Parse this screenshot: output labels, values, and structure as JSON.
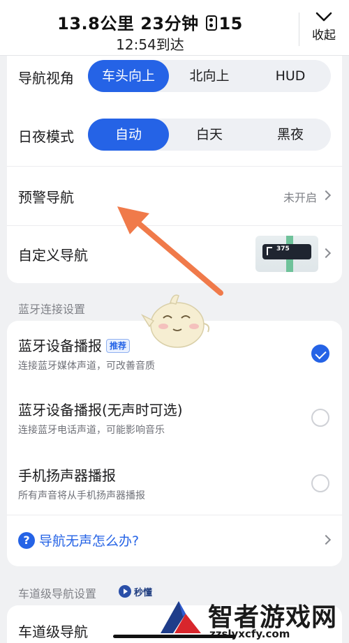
{
  "header": {
    "summary_distance": "13.8公里",
    "summary_time": "23分钟",
    "traffic_lights": "15",
    "eta": "12:54到达",
    "collapse_label": "收起"
  },
  "view_setting": {
    "label": "导航视角",
    "options": [
      "车头向上",
      "北向上",
      "HUD"
    ],
    "selected": "车头向上"
  },
  "day_night": {
    "label": "日夜模式",
    "options": [
      "自动",
      "白天",
      "黑夜"
    ],
    "selected": "自动"
  },
  "warning_nav": {
    "label": "预警导航",
    "status": "未开启"
  },
  "custom_nav": {
    "label": "自定义导航",
    "thumb_number": "375"
  },
  "bluetooth": {
    "section_title": "蓝牙连接设置",
    "items": [
      {
        "label": "蓝牙设备播报",
        "badge": "推荐",
        "desc": "连接蓝牙媒体声道，可改善音质",
        "checked": true
      },
      {
        "label": "蓝牙设备播报(无声时可选)",
        "desc": "连接蓝牙电话声道，可能影响音乐",
        "checked": false
      },
      {
        "label": "手机扬声器播报",
        "desc": "所有声音将从手机扬声器播报",
        "checked": false
      }
    ],
    "help_link": "导航无声怎么办?"
  },
  "lane_nav": {
    "section_title": "车道级导航设置",
    "video_badge": "秒懂",
    "row_label": "车道级导航"
  },
  "watermark": {
    "title": "智者游戏网",
    "url": "zzslyxcfy.com"
  },
  "colors": {
    "accent": "#2563e6",
    "annotation_arrow": "#f07a4a"
  },
  "icons": {
    "collapse": "chevron-down-icon",
    "row_next": "chevron-right-icon",
    "help": "question-circle-icon",
    "video": "play-circle-icon",
    "traffic_light": "traffic-light-icon"
  }
}
